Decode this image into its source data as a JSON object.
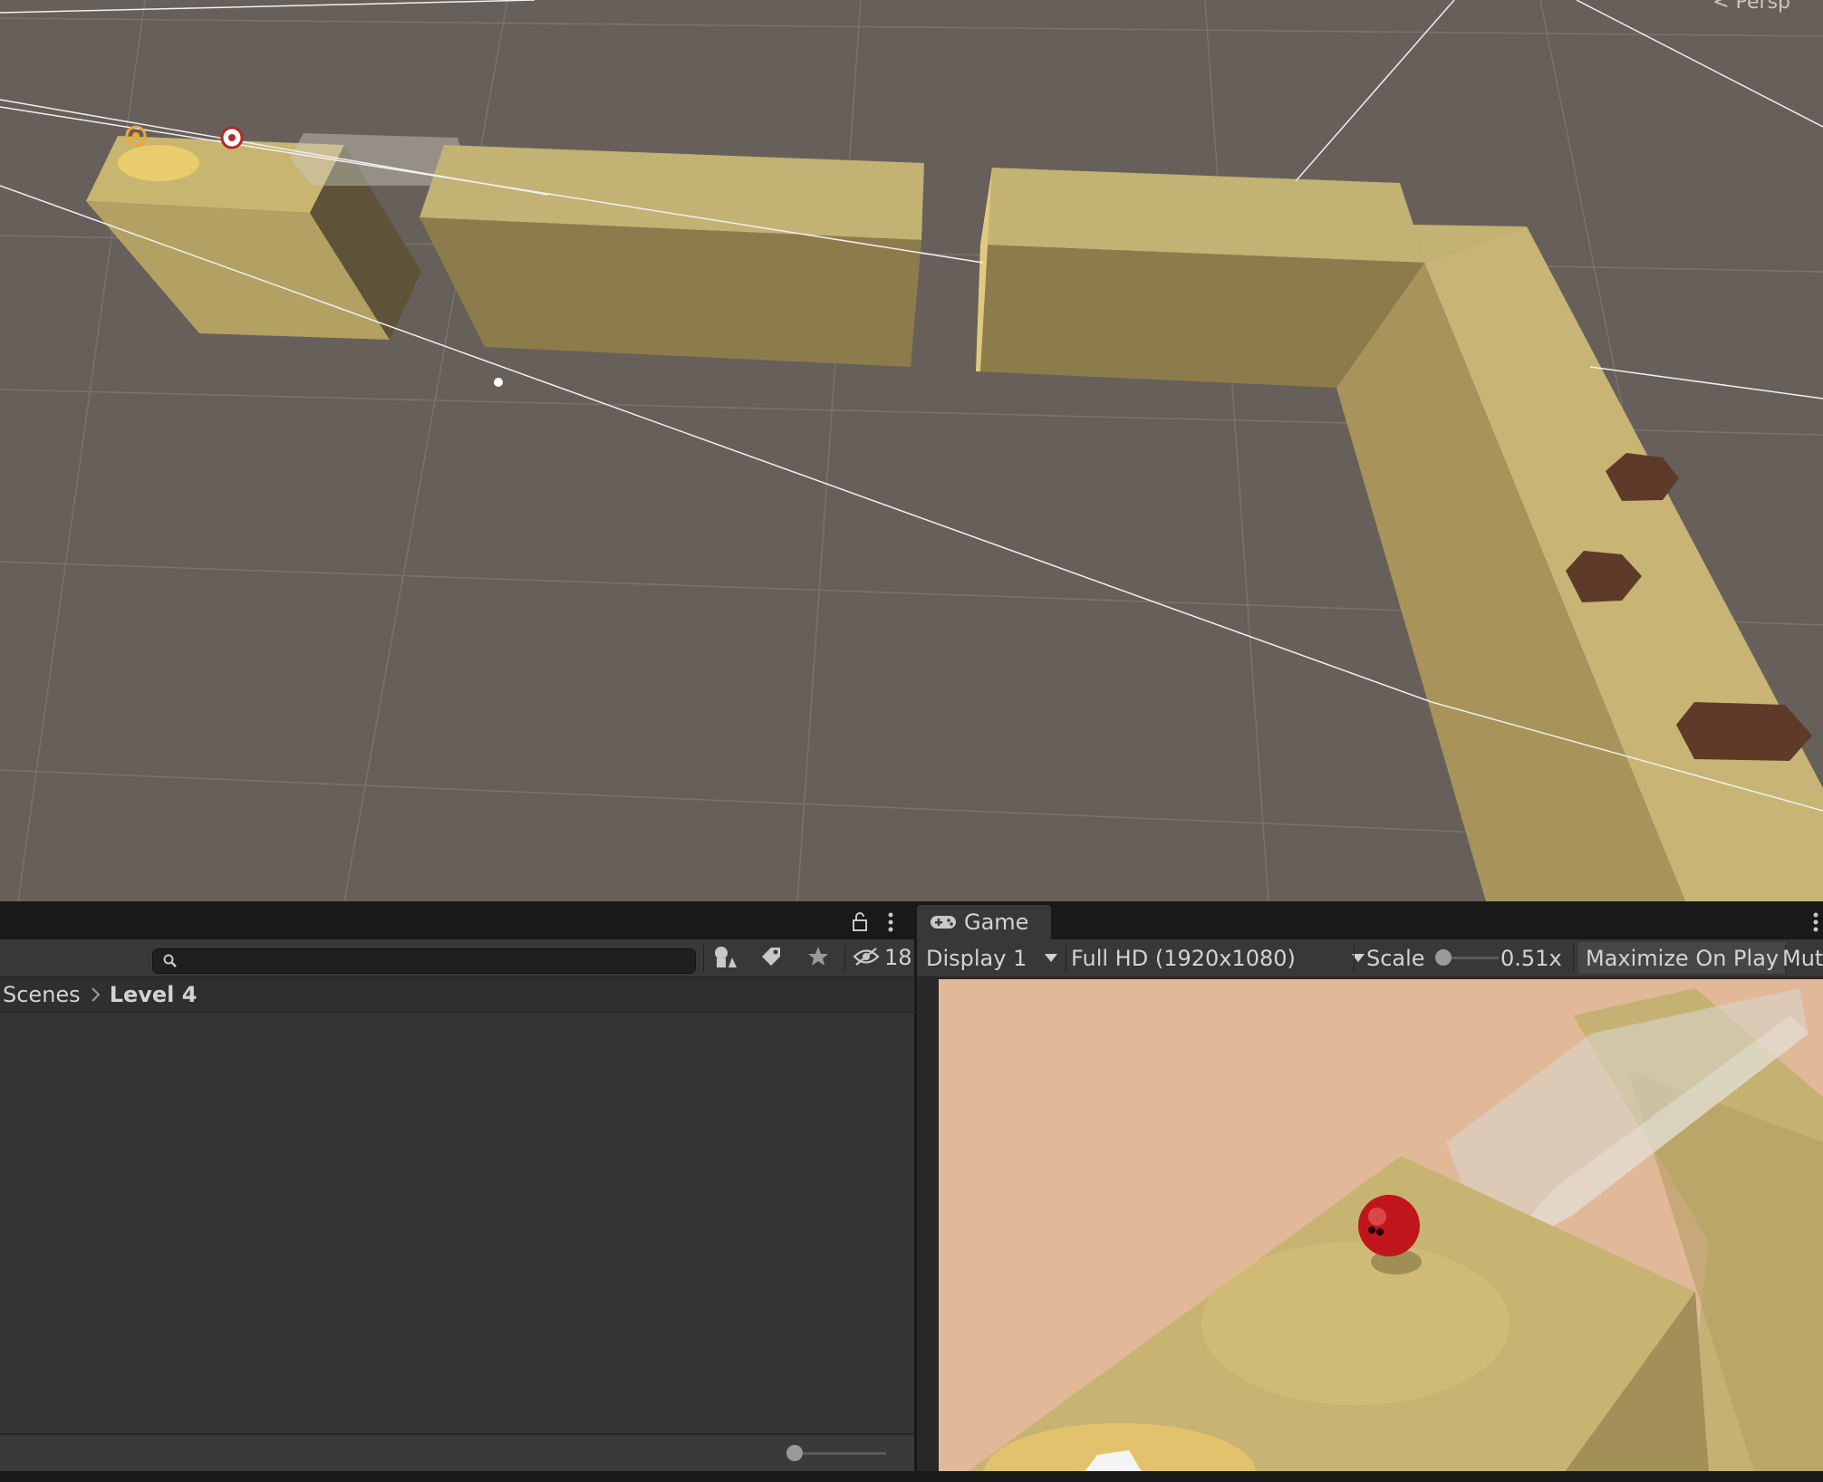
{
  "scene_view": {
    "projection_label": "< Persp"
  },
  "project_panel": {
    "search": {
      "value": "",
      "placeholder": ""
    },
    "hidden_packages_count": "18",
    "breadcrumb": {
      "root": "Scenes",
      "current": "Level 4"
    }
  },
  "game_panel": {
    "tab_label": "Game",
    "display": "Display 1",
    "resolution": "Full HD (1920x1080)",
    "scale_label": "Scale",
    "scale_value": "0.51x",
    "maximize_label": "Maximize On Play",
    "mute_label": "Mut"
  },
  "icons": [
    "lock-icon",
    "kebab-menu-icon",
    "search-icon",
    "filter-by-type-icon",
    "filter-by-label-icon",
    "favorites-icon",
    "hidden-packages-icon",
    "chevron-right-icon",
    "gamepad-icon",
    "caret-down-icon"
  ],
  "colors": {
    "scene_background": "#675f59",
    "block": "#c9b674",
    "block_shade": "#8c7b4b",
    "ball": "#c0161b",
    "game_sky": "#e1b998"
  }
}
